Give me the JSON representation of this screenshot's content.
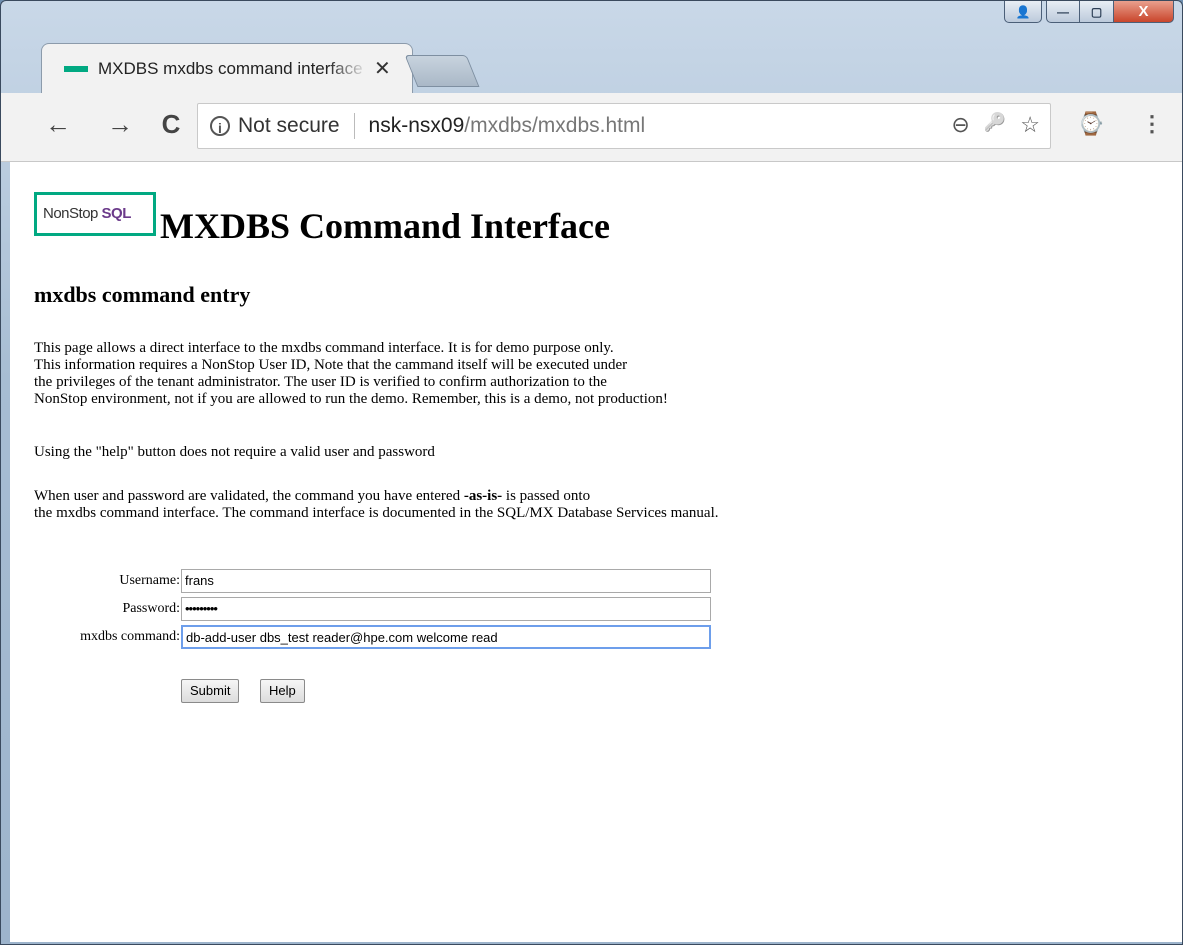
{
  "browser": {
    "tab_title": "MXDBS mxdbs command interface",
    "tab_close": "✕",
    "security_label": "Not secure",
    "url_host": "nsk-nsx09",
    "url_path": "/mxdbs/mxdbs.html",
    "nav_back": "←",
    "nav_forward": "→",
    "nav_reload": "C",
    "zoom_icon": "⊖",
    "key_icon": "🔑",
    "star_icon": "☆",
    "speed_icon": "⌚",
    "menu_icon": "⋮"
  },
  "window": {
    "close": "X"
  },
  "page": {
    "logo_text": "NonStop",
    "logo_sql": "SQL",
    "title": "MXDBS Command Interface",
    "subtitle": "mxdbs command entry",
    "para1": "This page allows a direct interface to the mxdbs command interface. It is for demo purpose only.\nThis information requires a NonStop User ID, Note that the cammand itself will be executed under\nthe privileges of the tenant administrator. The user ID is verified to confirm authorization to the\nNonStop environment, not if you are allowed to run the demo. Remember, this is a demo, not production!",
    "para2": "Using the \"help\" button does not require a valid user and password",
    "para3_a": "When user and password are validated, the command you have entered ",
    "para3_bold": "-as-is-",
    "para3_b": " is passed onto",
    "para3_c": "the mxdbs command interface. The command interface is documented in the SQL/MX Database Services manual."
  },
  "form": {
    "username_label": "Username:",
    "username_value": "frans",
    "password_label": "Password:",
    "password_value": "•••••••••",
    "command_label": "mxdbs command:",
    "command_value": "db-add-user dbs_test reader@hpe.com  welcome read",
    "submit_label": "Submit",
    "help_label": "Help"
  }
}
